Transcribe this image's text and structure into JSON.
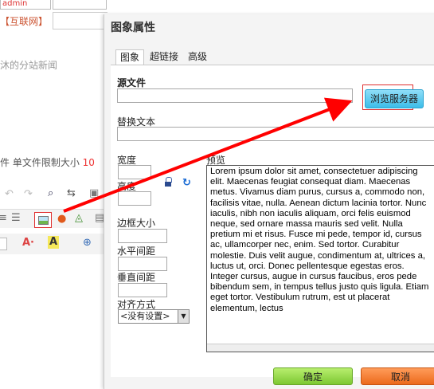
{
  "left": {
    "top_field": "admin",
    "tag": "【互联网】",
    "hint": "沐的分站新闻",
    "upload_label": "件 单文件限制大小",
    "upload_size": "10"
  },
  "dialog": {
    "title": "图象属性",
    "tabs": [
      "图象",
      "超链接",
      "高级"
    ],
    "source_label": "源文件",
    "source_value": "",
    "browse_label": "浏览服务器",
    "alt_label": "替换文本",
    "alt_value": "",
    "width_label": "宽度",
    "height_label": "高度",
    "border_label": "边框大小",
    "hspace_label": "水平间距",
    "vspace_label": "垂直间距",
    "align_label": "对齐方式",
    "align_value": "<没有设置>",
    "preview_label": "预览",
    "preview_text": "Lorem ipsum dolor sit amet, consectetuer adipiscing elit. Maecenas feugiat consequat diam. Maecenas metus. Vivamus diam purus, cursus a, commodo non, facilisis vitae, nulla. Aenean dictum lacinia tortor. Nunc iaculis, nibh non iaculis aliquam, orci felis euismod neque, sed ornare massa mauris sed velit. Nulla pretium mi et risus. Fusce mi pede, tempor id, cursus ac, ullamcorper nec, enim. Sed tortor. Curabitur molestie. Duis velit augue, condimentum at, ultrices a, luctus ut, orci. Donec pellentesque egestas eros. Integer cursus, augue in cursus faucibus, eros pede bibendum sem, in tempus tellus justo quis ligula. Etiam eget tortor. Vestibulum rutrum, est ut placerat elementum, lectus",
    "ok_label": "确定",
    "cancel_label": "取消"
  },
  "colors": {
    "annotation": "#ff0000",
    "browse": "#3cbde9",
    "ok": "#7cc832",
    "cancel": "#ec6a1c"
  }
}
